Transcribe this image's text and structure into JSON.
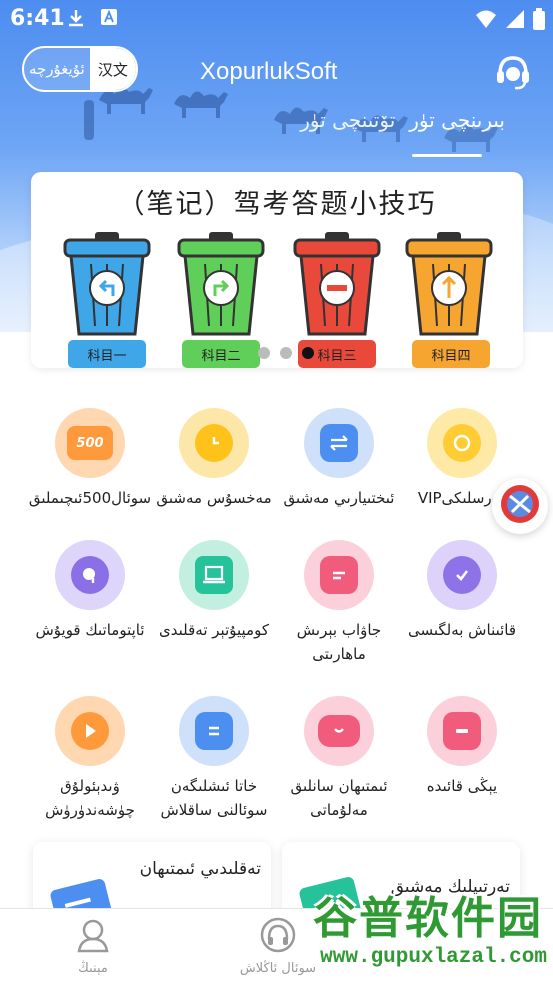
{
  "status_bar": {
    "time": "6:41",
    "icons_left": [
      "download-icon",
      "a-box-icon"
    ],
    "icons_right": [
      "wifi-icon",
      "signal-icon",
      "battery-icon"
    ]
  },
  "header": {
    "lang_ug": "ئۇيغۇرچە",
    "lang_cn": "汉文",
    "title": "XopurlukSoft",
    "support_icon": "headset-icon",
    "tabs": [
      {
        "label": "بىرىنچى تۈر",
        "active": true
      },
      {
        "label": "تۆتىنچى تۈر",
        "active": false
      }
    ]
  },
  "banner": {
    "title": "（笔记）驾考答题小技巧",
    "bins": [
      {
        "label": "科目一",
        "color": "#3fa6e8",
        "tag": "#3fa6e8",
        "icon": "turn-left-icon"
      },
      {
        "label": "科目二",
        "color": "#5fcf5a",
        "tag": "#5fcf5a",
        "icon": "turn-right-icon"
      },
      {
        "label": "科目三",
        "color": "#e8493b",
        "tag": "#e8493b",
        "icon": "no-entry-icon"
      },
      {
        "label": "科目四",
        "color": "#f7a531",
        "tag": "#f7a531",
        "icon": "arrow-up-icon"
      }
    ],
    "page_count": 3,
    "active_page": 2
  },
  "grid": [
    {
      "label": "VIPدەرسلىكى",
      "icon": "vip-icon",
      "color": "#ffcc33",
      "halo": "#ffe9a6"
    },
    {
      "label": "ئىختىيارىي مەشىق",
      "icon": "shuffle-icon",
      "color": "#4d8ff0",
      "halo": "#cfe0fb"
    },
    {
      "label": "مەخسۇس مەشىق",
      "icon": "clock-icon",
      "color": "#ffc21a",
      "halo": "#fde7a8"
    },
    {
      "label": "سوئال500ئىچىملىق",
      "icon": "500-icon",
      "color": "#ff9a3c",
      "halo": "#ffd7b0"
    },
    {
      "label": "قائىناش بەلگىسى",
      "icon": "shield-icon",
      "color": "#8e72e8",
      "halo": "#ddd3fa"
    },
    {
      "label": "جاۋاب بېرىش ماھارىتى",
      "icon": "chat-icon",
      "color": "#f25c7c",
      "halo": "#fcd0da"
    },
    {
      "label": "كومپيۇتېر تەقلىدى",
      "icon": "laptop-icon",
      "color": "#26c29a",
      "halo": "#c3efe1"
    },
    {
      "label": "ئاپتوماتىك قويۇش",
      "icon": "pie-icon",
      "color": "#8a6fe6",
      "halo": "#ddd5fa"
    },
    {
      "label": "يېڭى قائىدە",
      "icon": "minus-card-icon",
      "color": "#f25c7c",
      "halo": "#fcd0da"
    },
    {
      "label": "ئىمتىھان سانلىق مەلۇماتى",
      "icon": "cloud-icon",
      "color": "#f25c7c",
      "halo": "#fcd0da"
    },
    {
      "label": "خاتا ئىشلىگەن سوئالنى ساقلاش",
      "icon": "list-icon",
      "color": "#4d8ff0",
      "halo": "#cfe0fb"
    },
    {
      "label": "ۋىدېئولۇق چۈشەندۈرۈش",
      "icon": "play-icon",
      "color": "#ff9a3c",
      "halo": "#ffd7b0"
    }
  ],
  "cards": [
    {
      "text": "تەرتىپلىك مەشىق",
      "icon": "card-icon",
      "color": "#26c29a"
    },
    {
      "text": "تەقلىدىي ئىمتىھان",
      "icon": "card-icon",
      "color": "#4d8ff0"
    }
  ],
  "bottom_nav": [
    {
      "label": "مېنىڭ",
      "icon": "user-icon"
    },
    {
      "label": "سوئال ئاڭلاش",
      "icon": "headphones-icon"
    }
  ],
  "watermark": {
    "top": "谷普软件园",
    "bottom": "www.gupuxlazal.com"
  },
  "float_icon": "apk-icon"
}
